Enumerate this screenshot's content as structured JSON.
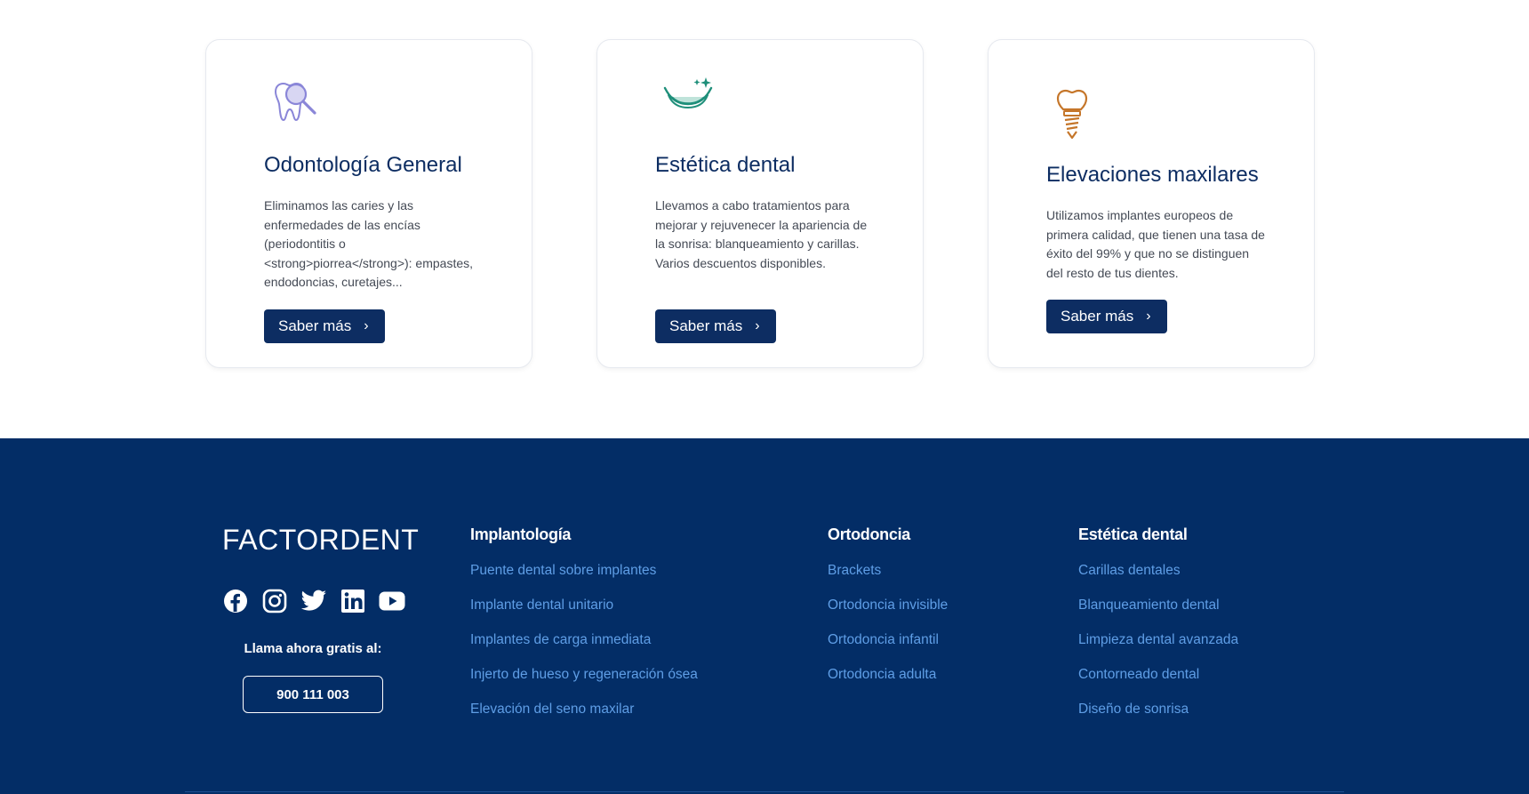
{
  "cards": [
    {
      "icon": "tooth-magnifier-icon",
      "title": "Odontología General",
      "description": "Eliminamos las caries y las enfermedades de las encías (periodontitis o <strong>piorrea</strong>): empastes, endodoncias, curetajes...",
      "button": "Saber más"
    },
    {
      "icon": "smile-sparkle-icon",
      "title": "Estética dental",
      "description": "Llevamos a cabo tratamientos para mejorar y rejuvenecer la apariencia de la sonrisa: blanqueamiento y carillas. Varios descuentos disponibles.",
      "button": "Saber más"
    },
    {
      "icon": "dental-implant-icon",
      "title": "Elevaciones maxilares",
      "description": "Utilizamos implantes europeos de primera calidad, que tienen una tasa de éxito del 99% y que no se distinguen del resto de tus dientes.",
      "button": "Saber más"
    }
  ],
  "footer": {
    "brand": "FACTORDENT",
    "socials": [
      "facebook-icon",
      "instagram-icon",
      "twitter-icon",
      "linkedin-icon",
      "youtube-icon"
    ],
    "call_label": "Llama ahora gratis al:",
    "phone": "900 111 003",
    "columns": [
      {
        "title": "Implantología",
        "links": [
          "Puente dental sobre implantes",
          "Implante dental unitario",
          "Implantes de carga inmediata",
          "Injerto de hueso y regeneración ósea",
          "Elevación del seno maxilar"
        ]
      },
      {
        "title": "Ortodoncia",
        "links": [
          "Brackets",
          "Ortodoncia invisible",
          "Ortodoncia infantil",
          "Ortodoncia adulta"
        ]
      },
      {
        "title": "Estética dental",
        "links": [
          "Carillas dentales",
          "Blanqueamiento dental",
          "Limpieza dental avanzada",
          "Contorneado dental",
          "Diseño de sonrisa"
        ]
      }
    ]
  },
  "colors": {
    "navy": "#032d66",
    "button": "#0d2d62",
    "link": "#5f9ee6",
    "icon_purple": "#8a86d8",
    "icon_teal": "#1f8f7a",
    "icon_orange": "#c5762a"
  }
}
